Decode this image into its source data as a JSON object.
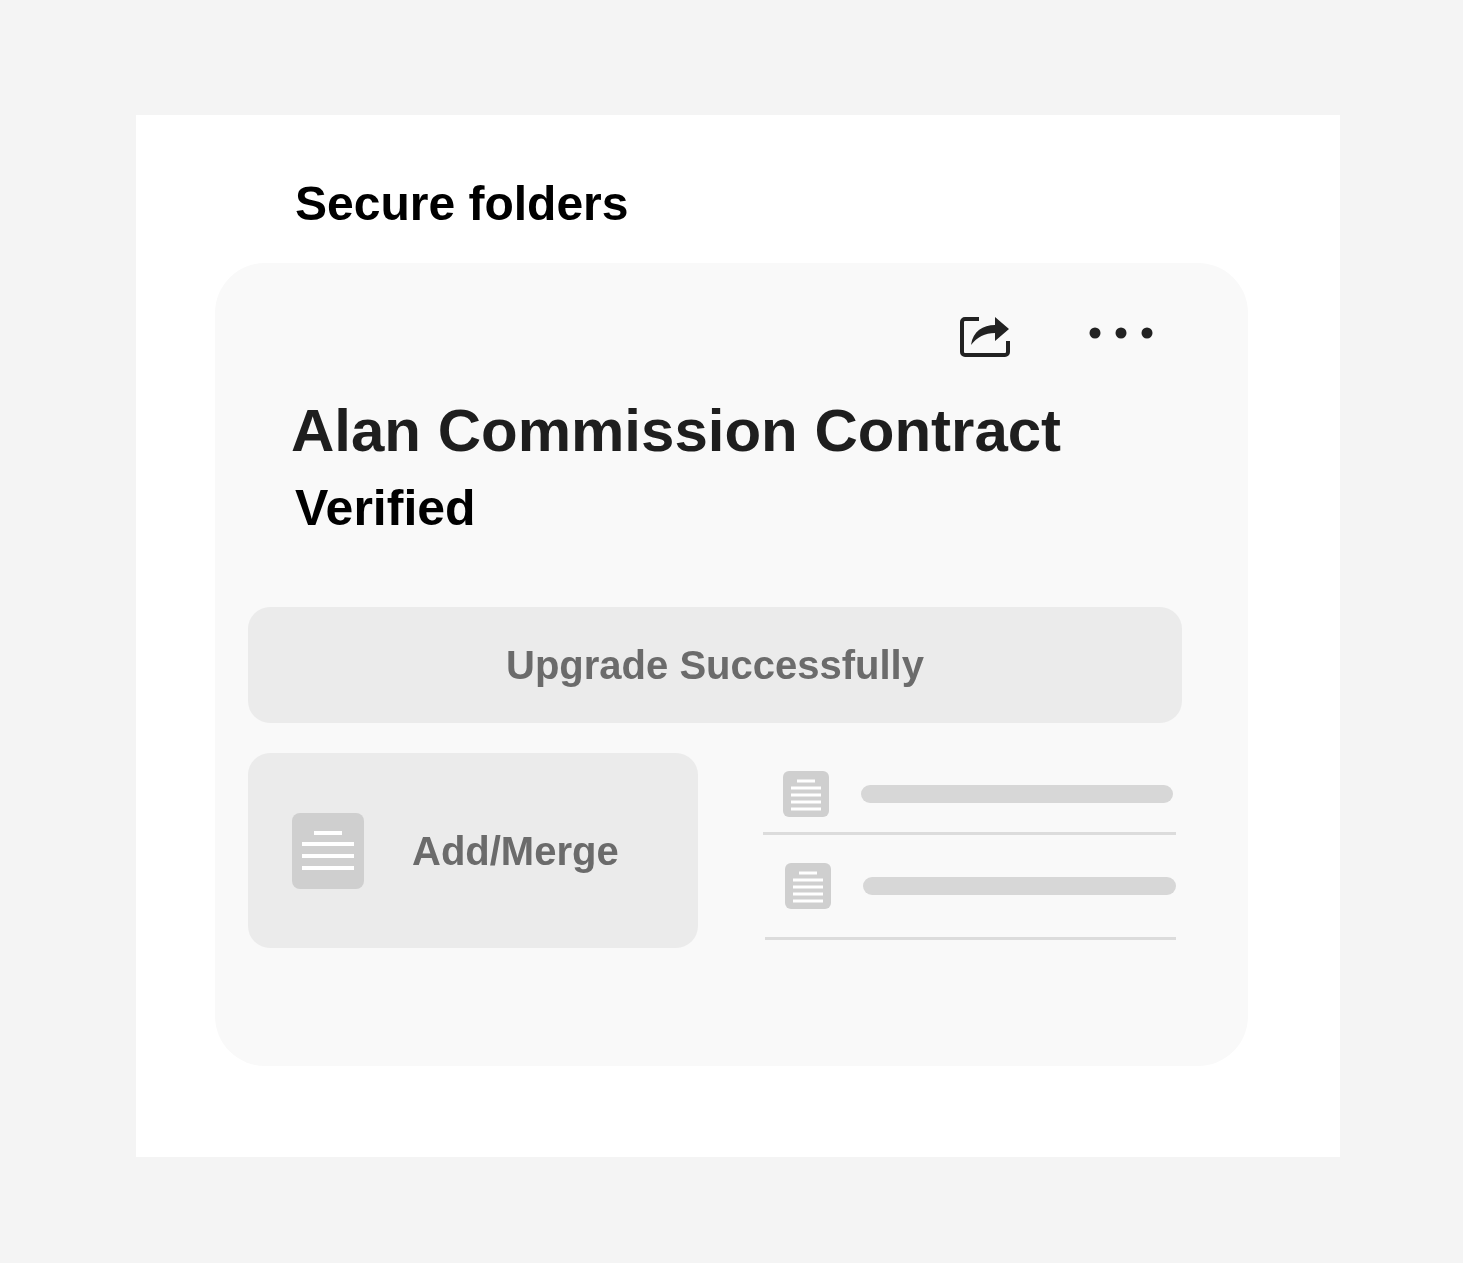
{
  "section_title": "Secure folders",
  "card": {
    "title": "Alan Commission Contract",
    "status": "Verified",
    "banner": "Upgrade Successfully",
    "action": "Add/Merge"
  }
}
